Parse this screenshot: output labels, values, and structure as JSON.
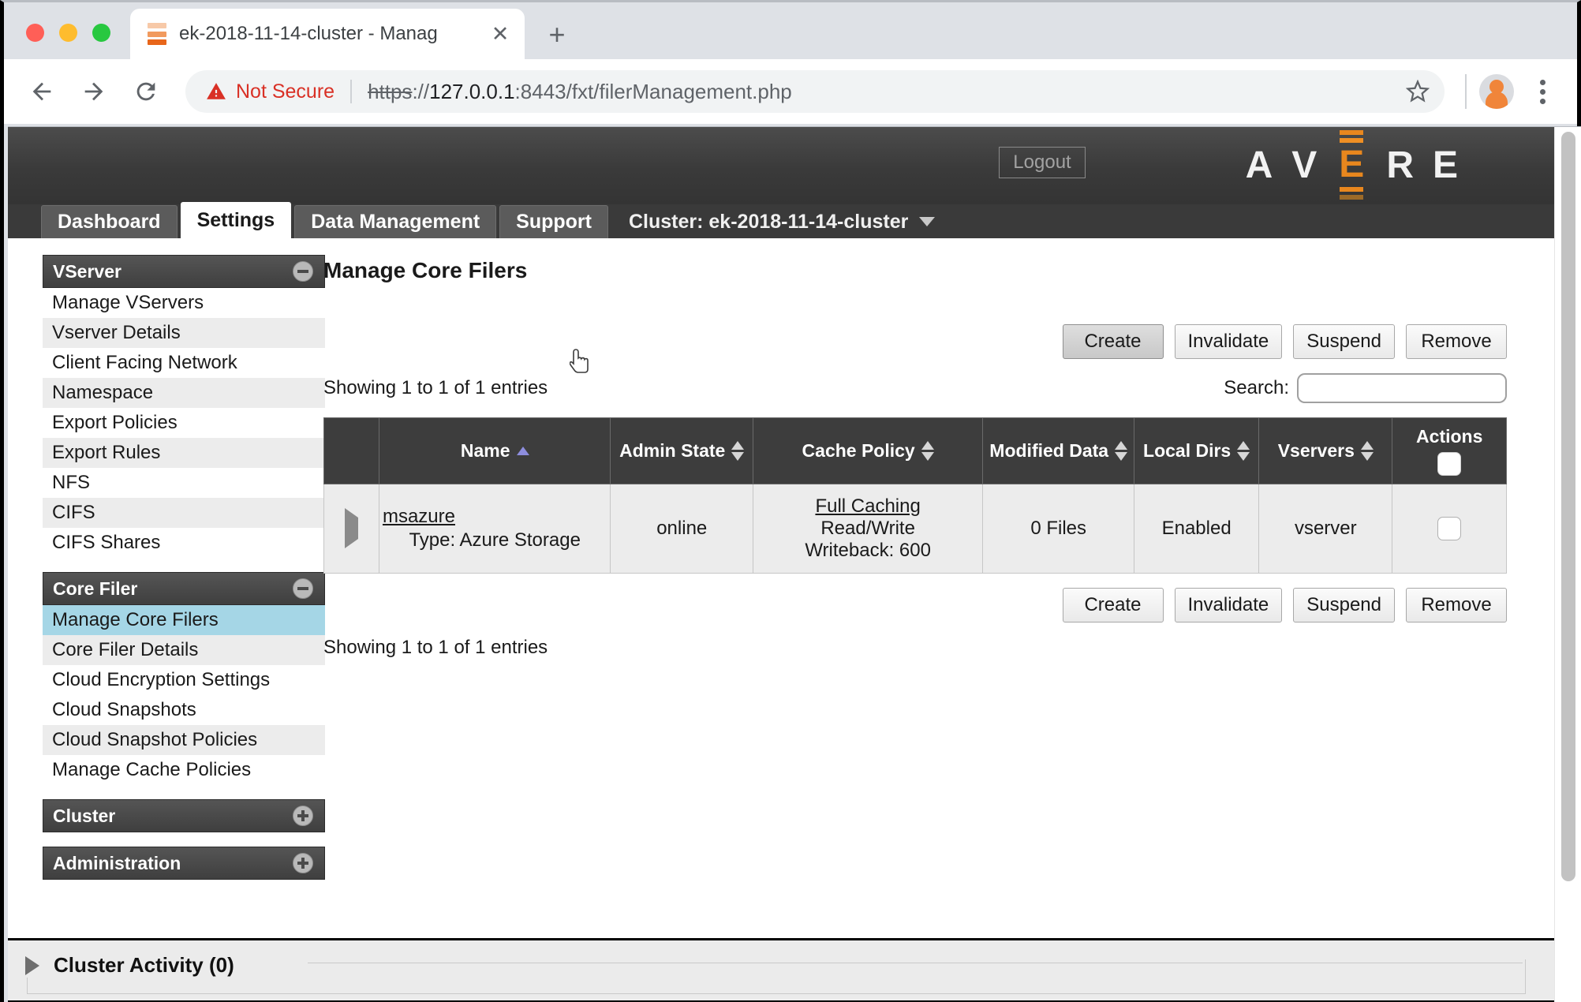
{
  "browser": {
    "tab_title": "ek-2018-11-14-cluster - Manag",
    "close_label": "✕",
    "new_tab_label": "+",
    "back_icon": "back-arrow-icon",
    "forward_icon": "forward-arrow-icon",
    "reload_icon": "reload-icon",
    "security_label": "Not Secure",
    "url": {
      "scheme": "https",
      "separator": "://",
      "host": "127.0.0.1",
      "rest": ":8443/fxt/filerManagement.php"
    },
    "favicon_colors": [
      "#f7c9a8",
      "#f19a5e",
      "#e8661a"
    ]
  },
  "app_header": {
    "logout_label": "Logout",
    "logo_letters": [
      "A",
      "V",
      "E",
      "R",
      "E"
    ],
    "logo_accent_color": "#e8871e",
    "logo_tick_colors": [
      "#e8871e",
      "#ef8f24",
      "#e8871e",
      "#9c6a28"
    ]
  },
  "nav": {
    "tabs": [
      {
        "label": "Dashboard",
        "active": false
      },
      {
        "label": "Settings",
        "active": true
      },
      {
        "label": "Data Management",
        "active": false
      },
      {
        "label": "Support",
        "active": false
      }
    ],
    "cluster_selector": "Cluster: ek-2018-11-14-cluster"
  },
  "sidebar": {
    "groups": [
      {
        "title": "VServer",
        "collapsed": false,
        "items": [
          {
            "label": "Manage VServers",
            "selected": false
          },
          {
            "label": "Vserver Details",
            "selected": false
          },
          {
            "label": "Client Facing Network",
            "selected": false
          },
          {
            "label": "Namespace",
            "selected": false
          },
          {
            "label": "Export Policies",
            "selected": false
          },
          {
            "label": "Export Rules",
            "selected": false
          },
          {
            "label": "NFS",
            "selected": false
          },
          {
            "label": "CIFS",
            "selected": false
          },
          {
            "label": "CIFS Shares",
            "selected": false
          }
        ]
      },
      {
        "title": "Core Filer",
        "collapsed": false,
        "items": [
          {
            "label": "Manage Core Filers",
            "selected": true
          },
          {
            "label": "Core Filer Details",
            "selected": false
          },
          {
            "label": "Cloud Encryption Settings",
            "selected": false
          },
          {
            "label": "Cloud Snapshots",
            "selected": false
          },
          {
            "label": "Cloud Snapshot Policies",
            "selected": false
          },
          {
            "label": "Manage Cache Policies",
            "selected": false
          }
        ]
      },
      {
        "title": "Cluster",
        "collapsed": true,
        "items": []
      },
      {
        "title": "Administration",
        "collapsed": true,
        "items": []
      }
    ]
  },
  "main": {
    "page_title": "Manage Core Filers",
    "top_buttons": [
      {
        "label": "Create",
        "hovered": true
      },
      {
        "label": "Invalidate",
        "hovered": false
      },
      {
        "label": "Suspend",
        "hovered": false
      },
      {
        "label": "Remove",
        "hovered": false
      }
    ],
    "bottom_buttons": [
      {
        "label": "Create",
        "hovered": false
      },
      {
        "label": "Invalidate",
        "hovered": false
      },
      {
        "label": "Suspend",
        "hovered": false
      },
      {
        "label": "Remove",
        "hovered": false
      }
    ],
    "entries_info_top": "Showing 1 to 1 of 1 entries",
    "entries_info_bottom": "Showing 1 to 1 of 1 entries",
    "search_label": "Search:",
    "search_value": "",
    "search_placeholder": "",
    "table": {
      "columns": [
        {
          "label": "",
          "sortable": false,
          "sort": "none"
        },
        {
          "label": "Name",
          "sortable": true,
          "sort": "asc"
        },
        {
          "label": "Admin State",
          "sortable": true,
          "sort": "none"
        },
        {
          "label": "Cache Policy",
          "sortable": true,
          "sort": "none"
        },
        {
          "label": "Modified Data",
          "sortable": true,
          "sort": "none"
        },
        {
          "label": "Local Dirs",
          "sortable": true,
          "sort": "none"
        },
        {
          "label": "Vservers",
          "sortable": true,
          "sort": "none"
        },
        {
          "label": "Actions",
          "sortable": false,
          "sort": "none"
        }
      ],
      "rows": [
        {
          "name": "msazure",
          "type": "Type: Azure Storage",
          "admin_state": "online",
          "cache_policy_name": "Full Caching",
          "cache_policy_mode": "Read/Write",
          "cache_policy_writeback": "Writeback: 600",
          "modified_data": "0 Files",
          "local_dirs": "Enabled",
          "vservers": "vserver",
          "checked": false
        }
      ]
    }
  },
  "footer": {
    "cluster_activity_label": "Cluster Activity (0)"
  }
}
